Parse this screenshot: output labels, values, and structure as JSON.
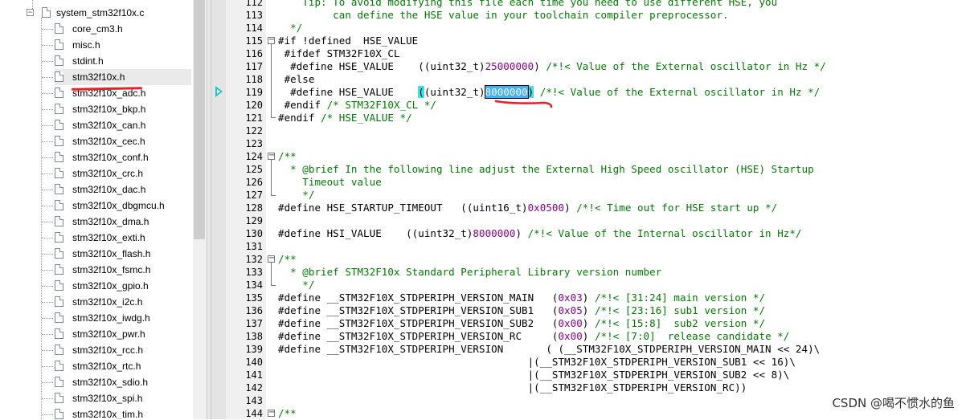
{
  "tree": {
    "parent_file": "system_stm32f10x.c",
    "files": [
      "core_cm3.h",
      "misc.h",
      "stdint.h",
      "stm32f10x.h",
      "stm32f10x_adc.h",
      "stm32f10x_bkp.h",
      "stm32f10x_can.h",
      "stm32f10x_cec.h",
      "stm32f10x_conf.h",
      "stm32f10x_crc.h",
      "stm32f10x_dac.h",
      "stm32f10x_dbgmcu.h",
      "stm32f10x_dma.h",
      "stm32f10x_exti.h",
      "stm32f10x_flash.h",
      "stm32f10x_fsmc.h",
      "stm32f10x_gpio.h",
      "stm32f10x_i2c.h",
      "stm32f10x_iwdg.h",
      "stm32f10x_pwr.h",
      "stm32f10x_rcc.h",
      "stm32f10x_rtc.h",
      "stm32f10x_sdio.h",
      "stm32f10x_spi.h",
      "stm32f10x_tim.h"
    ],
    "selected_file": "stm32f10x.h"
  },
  "code_lines": [
    {
      "n": "112",
      "t": "    Tip: To avoid modifying this file each time you need to use different HSE, you",
      "cls": "cm"
    },
    {
      "n": "113",
      "t": "         can define the HSE value in your toolchain compiler preprocessor.",
      "cls": "cm"
    },
    {
      "n": "114",
      "t": "  */",
      "cls": "cm"
    },
    {
      "n": "115",
      "t": "#if !defined  HSE_VALUE",
      "cls": ""
    },
    {
      "n": "116",
      "t": " #ifdef STM32F10X_CL",
      "cls": ""
    },
    {
      "n": "117",
      "p": [
        "  #define HSE_VALUE    ((uint32_t)",
        "25000000",
        ") ",
        "/*!< Value of the External oscillator in Hz */"
      ]
    },
    {
      "n": "118",
      "t": " #else",
      "cls": ""
    },
    {
      "n": "119",
      "p": [
        "  #define HSE_VALUE    ",
        "(",
        "(uint32_t)",
        "8000000",
        ")",
        " /*!< Value of the External oscillator in Hz */"
      ]
    },
    {
      "n": "120",
      "p": [
        " #endif ",
        "/* STM32F10X_CL */"
      ]
    },
    {
      "n": "121",
      "p": [
        "#endif ",
        "/* HSE_VALUE */"
      ]
    },
    {
      "n": "122",
      "t": "",
      "cls": ""
    },
    {
      "n": "123",
      "t": "",
      "cls": ""
    },
    {
      "n": "124",
      "t": "/**",
      "cls": "cm"
    },
    {
      "n": "125",
      "t": "  * @brief In the following line adjust the External High Speed oscillator (HSE) Startup",
      "cls": "cm"
    },
    {
      "n": "126",
      "t": "    Timeout value",
      "cls": "cm"
    },
    {
      "n": "127",
      "t": "    */",
      "cls": "cm"
    },
    {
      "n": "128",
      "p": [
        "#define HSE_STARTUP_TIMEOUT   ((uint16_t)",
        "0x0500",
        ") ",
        "/*!< Time out for HSE start up */"
      ]
    },
    {
      "n": "129",
      "t": "",
      "cls": ""
    },
    {
      "n": "130",
      "p": [
        "#define HSI_VALUE    ((uint32_t)",
        "8000000",
        ") ",
        "/*!< Value of the Internal oscillator in Hz*/"
      ]
    },
    {
      "n": "131",
      "t": "",
      "cls": ""
    },
    {
      "n": "132",
      "t": "/**",
      "cls": "cm"
    },
    {
      "n": "133",
      "t": "  * @brief STM32F10x Standard Peripheral Library version number",
      "cls": "cm"
    },
    {
      "n": "134",
      "t": "    */",
      "cls": "cm"
    },
    {
      "n": "135",
      "p": [
        "#define __STM32F10X_STDPERIPH_VERSION_MAIN   (",
        "0x03",
        ") ",
        "/*!< [31:24] main version */"
      ]
    },
    {
      "n": "136",
      "p": [
        "#define __STM32F10X_STDPERIPH_VERSION_SUB1   (",
        "0x05",
        ") ",
        "/*!< [23:16] sub1 version */"
      ]
    },
    {
      "n": "137",
      "p": [
        "#define __STM32F10X_STDPERIPH_VERSION_SUB2   (",
        "0x00",
        ") ",
        "/*!< [15:8]  sub2 version */"
      ]
    },
    {
      "n": "138",
      "p": [
        "#define __STM32F10X_STDPERIPH_VERSION_RC     (",
        "0x00",
        ") ",
        "/*!< [7:0]  release candidate */"
      ]
    },
    {
      "n": "139",
      "t": "#define __STM32F10X_STDPERIPH_VERSION       ( (__STM32F10X_STDPERIPH_VERSION_MAIN << 24)\\",
      "cls": ""
    },
    {
      "n": "140",
      "t": "                                         |(__STM32F10X_STDPERIPH_VERSION_SUB1 << 16)\\",
      "cls": ""
    },
    {
      "n": "141",
      "t": "                                         |(__STM32F10X_STDPERIPH_VERSION_SUB2 << 8)\\",
      "cls": ""
    },
    {
      "n": "142",
      "t": "                                         |(__STM32F10X_STDPERIPH_VERSION_RC))",
      "cls": ""
    },
    {
      "n": "143",
      "t": "",
      "cls": ""
    },
    {
      "n": "144",
      "t": "/**",
      "cls": "cm"
    }
  ],
  "watermark": "CSDN @喝不惯水的鱼",
  "colors": {
    "comment": "#007a00",
    "number": "#8a008a",
    "highlight": "#3fe0e6",
    "annotation": "#e8202a"
  }
}
